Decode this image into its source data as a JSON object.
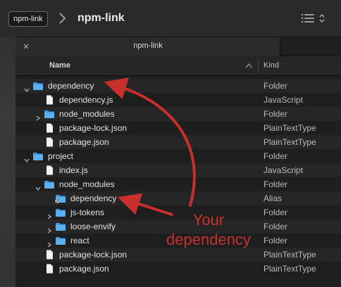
{
  "toolbar": {
    "path_pill": "npm-link",
    "title": "npm-link"
  },
  "tab": {
    "label": "npm-link"
  },
  "columns": {
    "name": "Name",
    "kind": "Kind"
  },
  "rows": [
    {
      "name": "dependency",
      "kind": "Folder",
      "icon": "folder",
      "depth": 0,
      "disclosure": "open"
    },
    {
      "name": "dependency.js",
      "kind": "JavaScript",
      "icon": "file",
      "depth": 1,
      "disclosure": "none"
    },
    {
      "name": "node_modules",
      "kind": "Folder",
      "icon": "folder",
      "depth": 1,
      "disclosure": "closed"
    },
    {
      "name": "package-lock.json",
      "kind": "PlainTextType",
      "icon": "file",
      "depth": 1,
      "disclosure": "none"
    },
    {
      "name": "package.json",
      "kind": "PlainTextType",
      "icon": "file",
      "depth": 1,
      "disclosure": "none"
    },
    {
      "name": "project",
      "kind": "Folder",
      "icon": "folder",
      "depth": 0,
      "disclosure": "open"
    },
    {
      "name": "index.js",
      "kind": "JavaScript",
      "icon": "file",
      "depth": 1,
      "disclosure": "none"
    },
    {
      "name": "node_modules",
      "kind": "Folder",
      "icon": "folder",
      "depth": 1,
      "disclosure": "open"
    },
    {
      "name": "dependency",
      "kind": "Alias",
      "icon": "alias-folder",
      "depth": 2,
      "disclosure": "none"
    },
    {
      "name": "js-tokens",
      "kind": "Folder",
      "icon": "folder",
      "depth": 2,
      "disclosure": "closed"
    },
    {
      "name": "loose-envify",
      "kind": "Folder",
      "icon": "folder",
      "depth": 2,
      "disclosure": "closed"
    },
    {
      "name": "react",
      "kind": "Folder",
      "icon": "folder",
      "depth": 2,
      "disclosure": "closed"
    },
    {
      "name": "package-lock.json",
      "kind": "PlainTextType",
      "icon": "file",
      "depth": 1,
      "disclosure": "none"
    },
    {
      "name": "package.json",
      "kind": "PlainTextType",
      "icon": "file",
      "depth": 1,
      "disclosure": "none"
    }
  ],
  "annotation": {
    "line1": "Your",
    "line2": "dependency",
    "color": "#c8302c"
  },
  "colors": {
    "folder": "#3d9be9",
    "file": "#f2f2f2"
  }
}
